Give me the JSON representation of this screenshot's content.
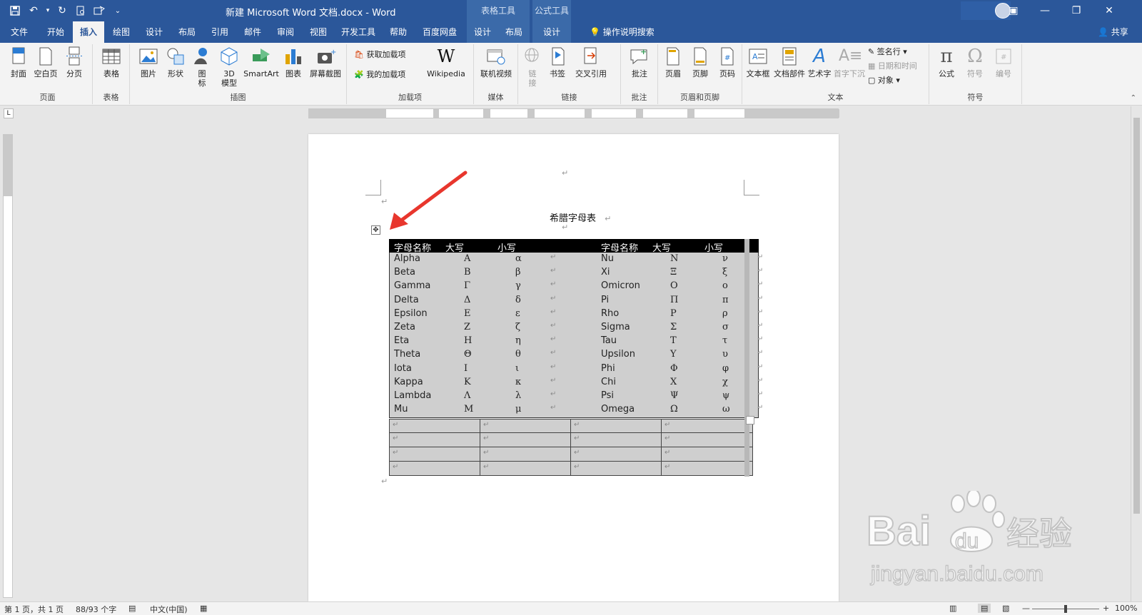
{
  "titlebar": {
    "doc_title": "新建 Microsoft Word 文档.docx  -  Word",
    "ctx_table_tools": "表格工具",
    "ctx_equation_tools": "公式工具"
  },
  "tabs": {
    "file": "文件",
    "home": "开始",
    "insert": "插入",
    "draw": "绘图",
    "design": "设计",
    "layout": "布局",
    "references": "引用",
    "mailings": "邮件",
    "review": "审阅",
    "view": "视图",
    "developer": "开发工具",
    "help": "帮助",
    "baidu": "百度网盘",
    "table_design": "设计",
    "table_layout": "布局",
    "eq_design": "设计",
    "tell_me": "操作说明搜索",
    "share": "共享"
  },
  "ribbon": {
    "pages": {
      "label": "页面",
      "cover": "封面",
      "blank": "空白页",
      "break": "分页"
    },
    "tables": {
      "label": "表格",
      "table": "表格"
    },
    "illustrations": {
      "label": "插图",
      "pictures": "图片",
      "shapes": "形状",
      "icons": "图\n标",
      "model3d": "3D\n模型",
      "smartart": "SmartArt",
      "chart": "图表",
      "screenshot": "屏幕截图"
    },
    "addins": {
      "label": "加载项",
      "get": "获取加载项",
      "my": "我的加载项",
      "wikipedia": "Wikipedia",
      "wiki_letter": "W"
    },
    "media": {
      "label": "媒体",
      "video": "联机视频"
    },
    "links": {
      "label": "链接",
      "link": "链\n接",
      "bookmark": "书签",
      "crossref": "交叉引用"
    },
    "comments": {
      "label": "批注",
      "comment": "批注"
    },
    "headerfooter": {
      "label": "页眉和页脚",
      "header": "页眉",
      "footer": "页脚",
      "pagenum": "页码"
    },
    "text": {
      "label": "文本",
      "textbox": "文本框",
      "quickparts": "文档部件",
      "wordart": "艺术字",
      "dropcap": "首字下沉",
      "signature": "签名行",
      "datetime": "日期和时间",
      "object": "对象"
    },
    "symbols": {
      "label": "符号",
      "equation": "公式",
      "symbol": "符号",
      "number": "编号",
      "pi": "π",
      "omega": "Ω"
    }
  },
  "document": {
    "heading": "希腊字母表",
    "para_mark": "↵",
    "table_headers": [
      "字母名称",
      "大写",
      "小写",
      "字母名称",
      "大写",
      "小写"
    ],
    "rows": [
      [
        "Alpha",
        "Α",
        "α",
        "Nu",
        "Ν",
        "ν"
      ],
      [
        "Beta",
        "Β",
        "β",
        "Xi",
        "Ξ",
        "ξ"
      ],
      [
        "Gamma",
        "Γ",
        "γ",
        "Omicron",
        "Ο",
        "ο"
      ],
      [
        "Delta",
        "Δ",
        "δ",
        "Pi",
        "Π",
        "π"
      ],
      [
        "Epsilon",
        "Ε",
        "ε",
        "Rho",
        "Ρ",
        "ρ"
      ],
      [
        "Zeta",
        "Ζ",
        "ζ",
        "Sigma",
        "Σ",
        "σ"
      ],
      [
        "Eta",
        "Η",
        "η",
        "Tau",
        "Τ",
        "τ"
      ],
      [
        "Theta",
        "Θ",
        "θ",
        "Upsilon",
        "Υ",
        "υ"
      ],
      [
        "Iota",
        "Ι",
        "ι",
        "Phi",
        "Φ",
        "φ"
      ],
      [
        "Kappa",
        "Κ",
        "κ",
        "Chi",
        "Χ",
        "χ"
      ],
      [
        "Lambda",
        "Λ",
        "λ",
        "Psi",
        "Ψ",
        "ψ"
      ],
      [
        "Mu",
        "Μ",
        "μ",
        "Omega",
        "Ω",
        "ω"
      ]
    ],
    "empty_rows": 4,
    "arrow_color": "#e8362d"
  },
  "statusbar": {
    "page": "第 1 页，共 1 页",
    "words": "88/93 个字",
    "language": "中文(中国)",
    "zoom": "100%"
  },
  "watermark": {
    "brand_left": "Bai",
    "brand_right": "经验",
    "url": "jingyan.baidu.com"
  }
}
